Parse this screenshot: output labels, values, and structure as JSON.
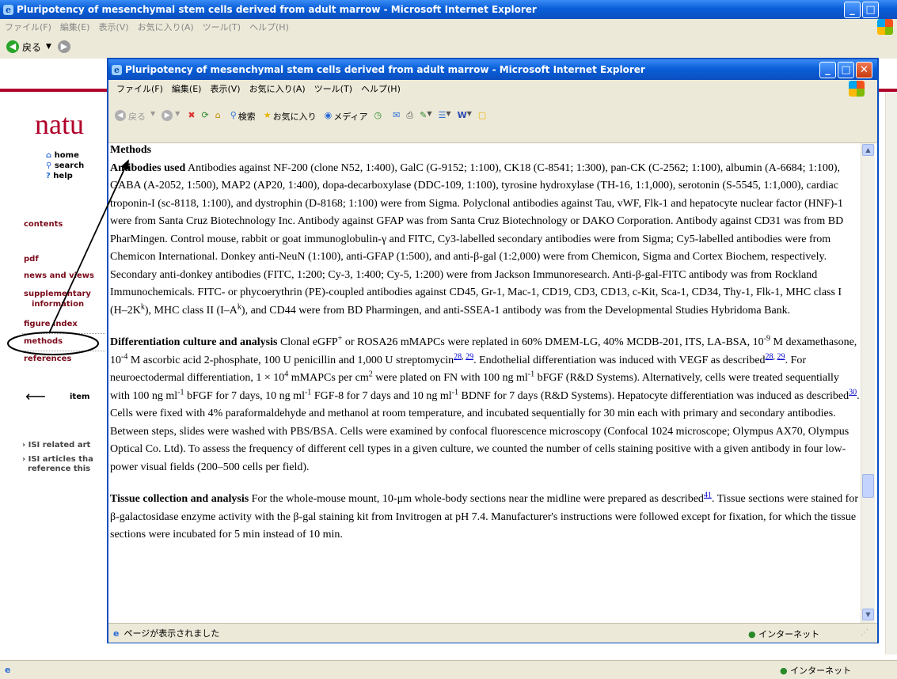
{
  "outer_window": {
    "title": "Pluripotency of mesenchymal stem cells derived from adult marrow - Microsoft Internet Explorer",
    "menu": [
      "ファイル(F)",
      "編集(E)",
      "表示(V)",
      "お気に入り(A)",
      "ツール(T)",
      "ヘルプ(H)"
    ],
    "back_label": "戻る",
    "status_zone": "インターネット"
  },
  "sidebar": {
    "logo": "natu",
    "links": [
      {
        "label": "home",
        "icon": "home-icon"
      },
      {
        "label": "search",
        "icon": "search-icon"
      },
      {
        "label": "help",
        "icon": "help-icon"
      }
    ],
    "items": {
      "contents": "contents",
      "pdf": "pdf",
      "news": "news and views",
      "supp1": "supplementary",
      "supp2": "information",
      "figure_index": "figure index",
      "methods": "methods",
      "references": "references",
      "item": "item",
      "isi1": "ISI related art",
      "isi2a": "ISI articles tha",
      "isi2b": "reference this"
    }
  },
  "inner_window": {
    "title": "Pluripotency of mesenchymal stem cells derived from adult marrow - Microsoft Internet Explorer",
    "menu": [
      "ファイル(F)",
      "編集(E)",
      "表示(V)",
      "お気に入り(A)",
      "ツール(T)",
      "ヘルプ(H)"
    ],
    "toolbar": {
      "back": "戻る",
      "search": "検索",
      "favorites": "お気に入り",
      "media": "メディア"
    },
    "status_text": "ページが表示されました",
    "status_zone": "インターネット"
  },
  "article": {
    "heading": "Methods",
    "s1_title": "Antibodies used",
    "s1_body": "Antibodies against NF-200 (clone N52, 1:400), GalC (G-9152; 1:100), CK18 (C-8541; 1:300), pan-CK (C-2562; 1:100), albumin (A-6684; 1:100), GABA (A-2052, 1:500), MAP2 (AP20, 1:400), dopa-decarboxylase (DDC-109, 1:100), tyrosine hydroxylase (TH-16, 1:1,000), serotonin (S-5545, 1:1,000), cardiac troponin-I (sc-8118, 1:100), and dystrophin (D-8168; 1:100) were from Sigma. Polyclonal antibodies against Tau, vWF, Flk-1 and hepatocyte nuclear factor (HNF)-1 were from Santa Cruz Biotechnology Inc. Antibody against GFAP was from Santa Cruz Biotechnology or DAKO Corporation. Antibody against CD31 was from BD PharMingen. Control mouse, rabbit or goat immunoglobulin-γ and FITC, Cy3-labelled secondary antibodies were from Sigma; Cy5-labelled antibodies were from Chemicon International. Donkey anti-NeuN (1:100), anti-GFAP (1:500), and anti-β-gal (1:2,000) were from Chemicon, Sigma and Cortex Biochem, respectively. Secondary anti-donkey antibodies (FITC, 1:200; Cy-3, 1:400; Cy-5, 1:200) were from Jackson Immunoresearch. Anti-β-gal-FITC antibody was from Rockland Immunochemicals. FITC- or phycoerythrin (PE)-coupled antibodies against CD45, Gr-1, Mac-1, CD19, CD3, CD13, c-Kit, Sca-1, CD34, Thy-1, Flk-1, MHC class I (H–2K",
    "s1_sup1": "k",
    "s1_mid": "), MHC class II (I–A",
    "s1_sup2": "k",
    "s1_end": "), and CD44 were from BD Pharmingen, and anti-SSEA-1 antibody was from the Developmental Studies Hybridoma Bank.",
    "s2_title": "Differentiation culture and analysis",
    "s2_a": "Clonal eGFP",
    "s2_plus": "+",
    "s2_b": " or ROSA26 mMAPCs were replated in 60% DMEM-LG, 40% MCDB-201, ITS, LA-BSA, 10",
    "s2_e1": "-9",
    "s2_c": " M dexamethasone, 10",
    "s2_e2": "-4",
    "s2_d": " M ascorbic acid 2-phosphate, 100 U penicillin and 1,000 U streptomycin",
    "ref28": "28",
    "ref29": "29",
    "s2_e": ". Endothelial differentiation was induced with VEGF as described",
    "s2_f": ". For neuroectodermal differentiation, 1 × 10",
    "s2_e3": "4",
    "s2_g": " mMAPCs per cm",
    "s2_e4": "2",
    "s2_h": " were plated on FN with 100 ng ml",
    "s2_e5": "-1",
    "s2_i": " bFGF (R&D Systems). Alternatively, cells were treated sequentially with 100 ng ml",
    "s2_j": " bFGF for 7 days, 10 ng ml",
    "s2_k": " FGF-8 for 7 days and 10 ng ml",
    "s2_l": " BDNF for 7 days (R&D Systems). Hepatocyte differentiation was induced as described",
    "ref30": "30",
    "s2_m": ". Cells were fixed with 4% paraformaldehyde and methanol at room temperature, and incubated sequentially for 30 min each with primary and secondary antibodies. Between steps, slides were washed with PBS/BSA. Cells were examined by confocal fluorescence microscopy (Confocal 1024 microscope; Olympus AX70, Olympus Optical Co. Ltd). To assess the frequency of different cell types in a given culture, we counted the number of cells staining positive with a given antibody in four low-power visual fields (200–500 cells per field).",
    "s3_title": "Tissue collection and analysis",
    "s3_a": "For the whole-mouse mount, 10-μm whole-body sections near the midline were prepared as described",
    "ref41": "41",
    "s3_b": ". Tissue sections were stained for β-galactosidase enzyme activity with the β-gal staining kit from Invitrogen at pH 7.4. Manufacturer's instructions were followed except for fixation, for which the tissue sections were incubated for 5 min instead of 10 min."
  }
}
